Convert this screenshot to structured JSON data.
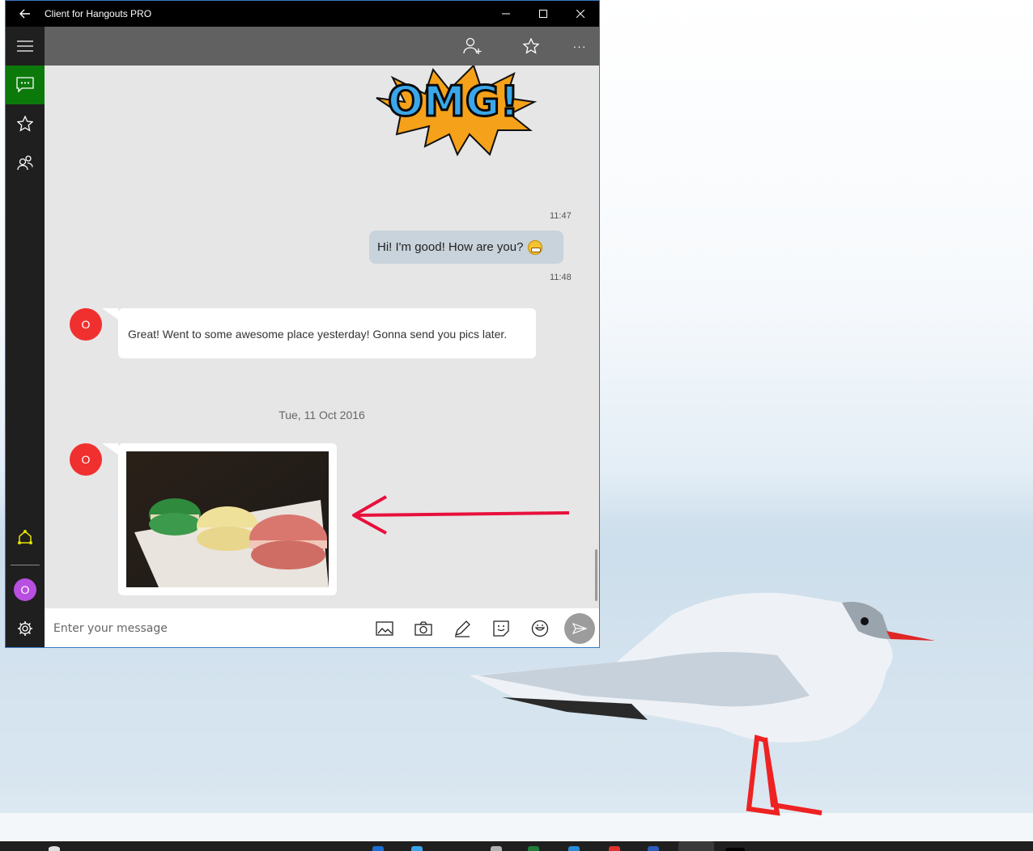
{
  "window": {
    "title": "Client for Hangouts PRO"
  },
  "header": {
    "add_person_icon": "add-person-icon",
    "favorite_icon": "star-icon",
    "more_label": "···"
  },
  "sidebar": {
    "items": [
      {
        "name": "menu",
        "icon": "hamburger-icon"
      },
      {
        "name": "conversations",
        "icon": "chat-icon",
        "active": true
      },
      {
        "name": "favorites",
        "icon": "star-icon"
      },
      {
        "name": "contacts",
        "icon": "people-icon"
      }
    ],
    "bottom": {
      "hangouts_icon": "hangouts-icon",
      "user_avatar_letter": "O",
      "settings_icon": "gear-icon"
    }
  },
  "chat": {
    "messages": [
      {
        "type": "sticker",
        "direction": "incoming",
        "sticker_text": "OMG!",
        "time": "11:47"
      },
      {
        "type": "text",
        "direction": "outgoing",
        "text": "Hi! I'm good! How are you?",
        "emoji": "grinning-face",
        "time": "11:48"
      },
      {
        "type": "text",
        "direction": "incoming",
        "avatar_letter": "O",
        "text": "Great! Went to some awesome place yesterday! Gonna send you pics later."
      },
      {
        "type": "date_separator",
        "text": "Tue, 11 Oct 2016"
      },
      {
        "type": "image",
        "direction": "incoming",
        "avatar_letter": "O",
        "content": "macarons photo"
      }
    ]
  },
  "composer": {
    "placeholder": "Enter your message",
    "buttons": [
      "image-icon",
      "camera-icon",
      "pen-icon",
      "sticker-icon",
      "emoji-icon",
      "send-icon"
    ]
  },
  "colors": {
    "accent_green": "#0b7a0b",
    "avatar_red": "#f0302f",
    "user_avatar_purple": "#b84fe0",
    "annotation_arrow": "#e8103c"
  }
}
